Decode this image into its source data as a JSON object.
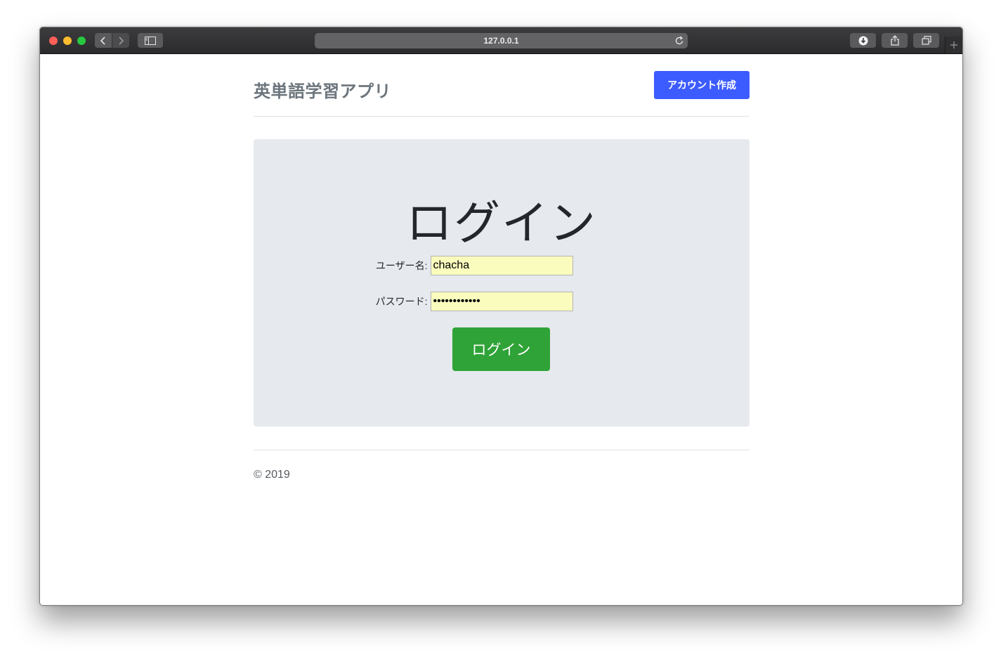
{
  "browser": {
    "address": "127.0.0.1"
  },
  "header": {
    "site_title": "英単語学習アプリ",
    "create_account_label": "アカウント作成"
  },
  "login": {
    "heading": "ログイン",
    "username_label": "ユーザー名:",
    "username_value": "chacha",
    "password_label": "パスワード:",
    "password_value": "chachapass12",
    "submit_label": "ログイン"
  },
  "footer": {
    "copyright": "© 2019"
  },
  "colors": {
    "primary_button": "#3d5cff",
    "login_button": "#2fa337",
    "jumbotron_bg": "#e6e9ed",
    "autofill_input_bg": "#fafcbd"
  }
}
